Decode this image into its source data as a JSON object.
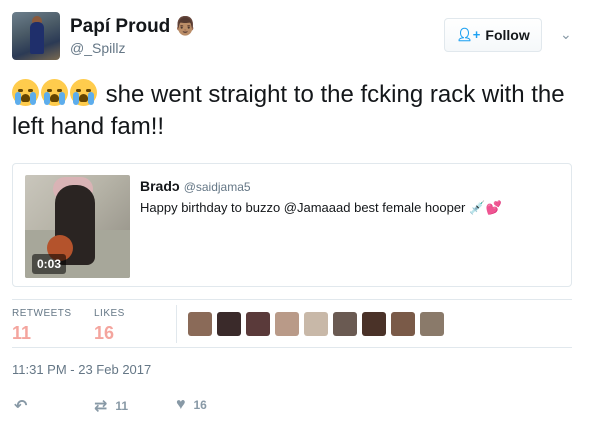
{
  "user": {
    "display_name": "Papí Proud",
    "name_emoji": "👨🏽",
    "handle": "@_Spillz",
    "avatar_icon": "profile-photo"
  },
  "follow": {
    "label": "Follow",
    "icon": "add-user-icon"
  },
  "tweet": {
    "text": "she went straight to the fcking rack with the left hand fam!!",
    "emojis": [
      "loudly-crying-face",
      "loudly-crying-face",
      "loudly-crying-face"
    ]
  },
  "quoted": {
    "name": "Bradↄ",
    "handle": "@saidjama5",
    "text": "Happy birthday to buzzo @Jamaaad best female hooper",
    "text_emojis": "💉💕",
    "video_duration": "0:03"
  },
  "stats": {
    "retweets_label": "RETWEETS",
    "retweets_value": "11",
    "likes_label": "LIKES",
    "likes_value": "16",
    "accent_color": "#f4a59e"
  },
  "likers": [
    {
      "color": "#8a6a58"
    },
    {
      "color": "#3a2a2a"
    },
    {
      "color": "#5a3a3a"
    },
    {
      "color": "#b99a88"
    },
    {
      "color": "#c8b8a8"
    },
    {
      "color": "#6a5a52"
    },
    {
      "color": "#4a3228"
    },
    {
      "color": "#7a5a48"
    },
    {
      "color": "#8a7a6a"
    }
  ],
  "timestamp": "11:31 PM - 23 Feb 2017",
  "actions": {
    "reply_icon": "reply-icon",
    "retweet_icon": "retweet-icon",
    "retweet_count": "11",
    "like_icon": "heart-icon",
    "like_count": "16"
  }
}
